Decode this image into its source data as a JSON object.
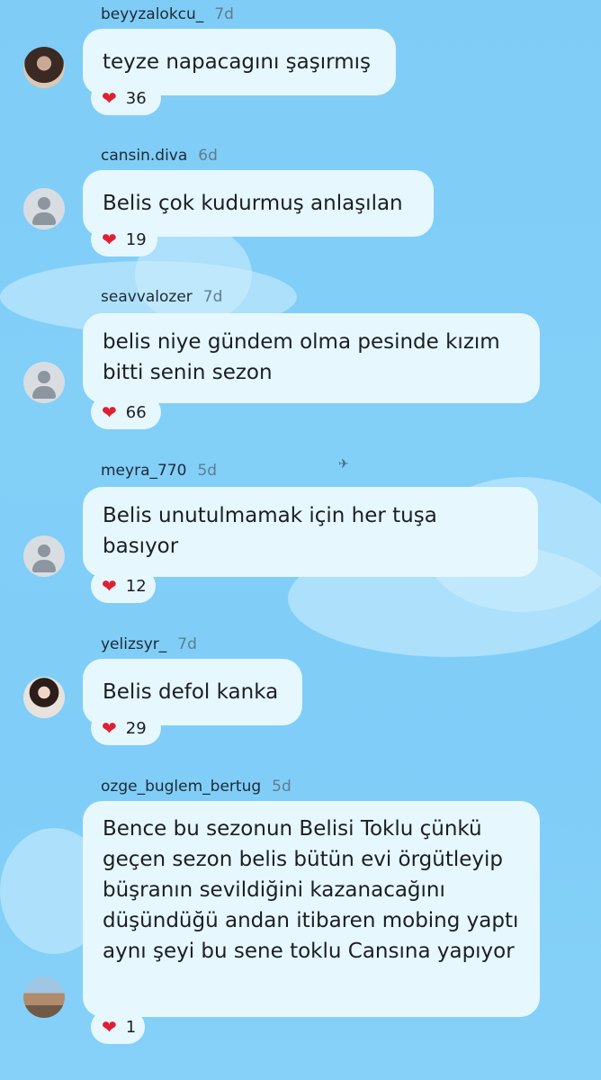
{
  "comments": [
    {
      "user": "beyyzalokcu_",
      "time": "7d",
      "text": "teyze napacagını şaşırmış",
      "likes": "36"
    },
    {
      "user": "cansin.diva",
      "time": "6d",
      "text": "Belis çok kudurmuş anlaşılan",
      "likes": "19"
    },
    {
      "user": "seavvalozer",
      "time": "7d",
      "text": "belis niye gündem olma pesinde kızım bitti senin sezon",
      "likes": "66"
    },
    {
      "user": "meyra_770",
      "time": "5d",
      "text": "Belis unutulmamak için her tuşa basıyor",
      "likes": "12"
    },
    {
      "user": "yelizsyr_",
      "time": "7d",
      "text": "Belis defol kanka",
      "likes": "29"
    },
    {
      "user": "ozge_buglem_bertug",
      "time": "5d",
      "text": "Bence bu sezonun Belisi Toklu çünkü geçen sezon belis bütün evi örgütleyip büşranın sevildiğini kazanacağını düşündüğü andan itibaren mobing yaptı aynı şeyi bu sene toklu Cansına yapıyor",
      "likes": "1"
    }
  ],
  "icons": {
    "like": "heart-icon",
    "avatar": "user-avatar-icon"
  }
}
